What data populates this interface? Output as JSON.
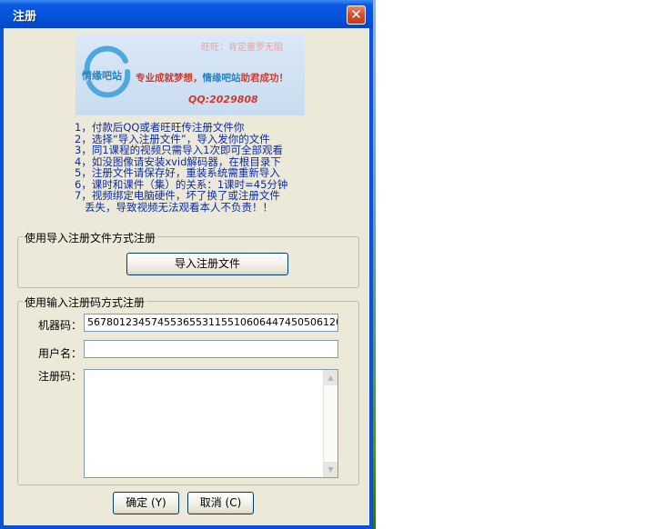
{
  "window": {
    "title": "注册",
    "close_glyph": "✕"
  },
  "banner": {
    "logo_text": "情缘吧站",
    "top_text": "旺旺：肯定童罗无阻",
    "slogan_part1": "专业成就梦想，",
    "slogan_part2": "情缘吧站",
    "slogan_part3": "助君成功！",
    "qq": "QQ:2029808"
  },
  "instructions": [
    "1，付款后QQ或者旺旺传注册文件你",
    "2，选择“导入注册文件”，导入发你的文件",
    "3，同1课程的视频只需导入1次即可全部观看",
    "4，如没图像请安装xvid解码器，在根目录下",
    "5，注册文件请保存好，重装系统需重新导入",
    "6，课时和课件（集）的关系：1课时=45分钟",
    "7，视频绑定电脑硬件，坏了换了或注册文件",
    "   丢失，导致视频无法观看本人不负责！！"
  ],
  "import_group": {
    "legend": "使用导入注册文件方式注册",
    "button_label": "导入注册文件"
  },
  "code_group": {
    "legend": "使用输入注册码方式注册",
    "machine_label": "机器码：",
    "machine_value": "567801234574553655311551060644745050612​0",
    "username_label": "用户名：",
    "username_value": "",
    "regcode_label": "注册码：",
    "regcode_value": ""
  },
  "buttons": {
    "ok": "确定 (Y)",
    "cancel": "取消 (C)"
  },
  "colors": {
    "titlebar": "#0553d8",
    "dialog_bg": "#ece9d8",
    "instruction_text": "#0b2aa8",
    "close_button": "#d9502d"
  }
}
